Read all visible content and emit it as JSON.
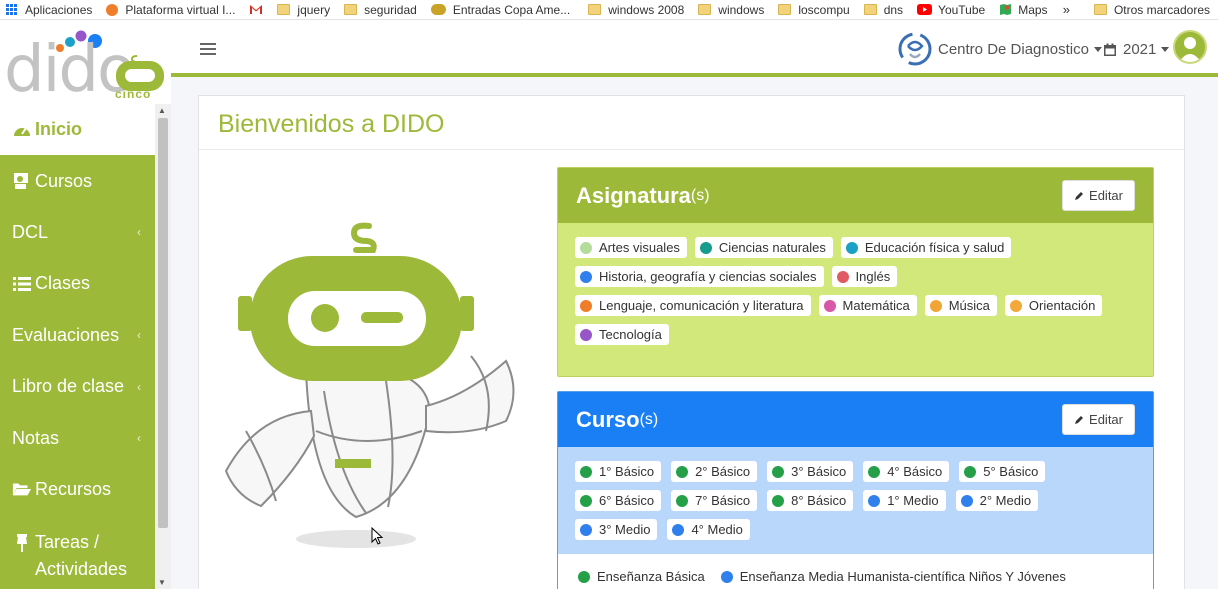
{
  "bookmarks": {
    "items": [
      {
        "label": "Aplicaciones",
        "icon": "apps-grid-icon"
      },
      {
        "label": "Plataforma virtual I...",
        "icon": "plataforma-icon"
      },
      {
        "label": "",
        "icon": "gmail-icon"
      },
      {
        "label": "jquery",
        "icon": "folder-icon"
      },
      {
        "label": "seguridad",
        "icon": "folder-icon"
      },
      {
        "label": "Entradas Copa Ame...",
        "icon": "ticket-icon"
      },
      {
        "label": "windows 2008",
        "icon": "folder-icon"
      },
      {
        "label": "windows",
        "icon": "folder-icon"
      },
      {
        "label": "loscompu",
        "icon": "folder-icon"
      },
      {
        "label": "dns",
        "icon": "folder-icon"
      },
      {
        "label": "YouTube",
        "icon": "youtube-icon"
      },
      {
        "label": "Maps",
        "icon": "maps-icon"
      }
    ],
    "overflow": "»",
    "other": "Otros marcadores"
  },
  "sidebar": {
    "logo_text": "dido",
    "logo_sub": "cinco",
    "items": [
      {
        "label": "Inicio",
        "icon": "dashboard-icon",
        "caret": ""
      },
      {
        "label": "Cursos",
        "icon": "teacher-icon",
        "caret": ""
      },
      {
        "label": "DCL",
        "icon": "",
        "caret": "‹"
      },
      {
        "label": "Clases",
        "icon": "list-icon",
        "caret": ""
      },
      {
        "label": "Evaluaciones",
        "icon": "",
        "caret": "‹"
      },
      {
        "label": "Libro de clase",
        "icon": "",
        "caret": "‹"
      },
      {
        "label": "Notas",
        "icon": "",
        "caret": "‹"
      },
      {
        "label": "Recursos",
        "icon": "folder-open-icon",
        "caret": ""
      },
      {
        "label_line1": "Tareas /",
        "label_line2": "Actividades",
        "icon": "pin-icon"
      }
    ]
  },
  "header": {
    "school": "Centro De Diagnostico",
    "year": "2021"
  },
  "main": {
    "title": "Bienvenidos a DIDO",
    "asignaturas": {
      "title": "Asignatura",
      "suffix": "(s)",
      "edit_label": "Editar",
      "items": [
        {
          "label": "Artes visuales",
          "color": "#b5dc9a"
        },
        {
          "label": "Ciencias naturales",
          "color": "#159c8c"
        },
        {
          "label": "Educación física y salud",
          "color": "#1ba0c8"
        },
        {
          "label": "Historia, geografía y ciencias sociales",
          "color": "#2f80ed"
        },
        {
          "label": "Inglés",
          "color": "#e05a64"
        },
        {
          "label": "Lenguaje, comunicación y literatura",
          "color": "#f07d2a"
        },
        {
          "label": "Matemática",
          "color": "#d957a8"
        },
        {
          "label": "Música",
          "color": "#f0a535"
        },
        {
          "label": "Orientación",
          "color": "#f2a83a"
        },
        {
          "label": "Tecnología",
          "color": "#9656c8"
        }
      ]
    },
    "cursos": {
      "title": "Curso",
      "suffix": "(s)",
      "edit_label": "Editar",
      "items": [
        {
          "label": "1° Básico",
          "color": "#25a049"
        },
        {
          "label": "2° Básico",
          "color": "#25a049"
        },
        {
          "label": "3° Básico",
          "color": "#25a049"
        },
        {
          "label": "4° Básico",
          "color": "#25a049"
        },
        {
          "label": "5° Básico",
          "color": "#25a049"
        },
        {
          "label": "6° Básico",
          "color": "#25a049"
        },
        {
          "label": "7° Básico",
          "color": "#25a049"
        },
        {
          "label": "8° Básico",
          "color": "#25a049"
        },
        {
          "label": "1° Medio",
          "color": "#2f80ed"
        },
        {
          "label": "2° Medio",
          "color": "#2f80ed"
        },
        {
          "label": "3° Medio",
          "color": "#2f80ed"
        },
        {
          "label": "4° Medio",
          "color": "#2f80ed"
        }
      ],
      "legend": [
        {
          "label": "Enseñanza Básica",
          "color": "#25a049"
        },
        {
          "label": "Enseñanza Media Humanista-científica Niños Y Jóvenes",
          "color": "#2f80ed"
        }
      ]
    }
  },
  "colors": {
    "brand": "#9db939",
    "brand_light": "#d3e87a",
    "blue": "#1a7ff5",
    "blue_light": "#b9d6fb"
  }
}
